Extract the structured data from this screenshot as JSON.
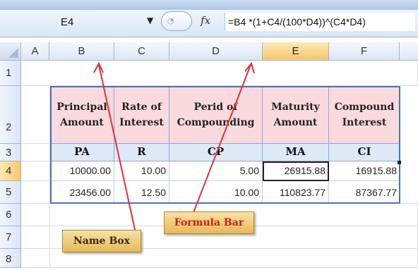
{
  "formula_bar": {
    "name_box": "E4",
    "fx_label": "fx",
    "formula": "=B4 *(1+C4/(100*D4))^(C4*D4)"
  },
  "columns": [
    "A",
    "B",
    "C",
    "D",
    "E",
    "F"
  ],
  "rows": [
    "1",
    "2",
    "3",
    "4",
    "5",
    "6",
    "7",
    "8"
  ],
  "table": {
    "headers": [
      [
        "Principal",
        "Amount"
      ],
      [
        "Rate of",
        "Interest"
      ],
      [
        "Perid of",
        "Compounding"
      ],
      [
        "Maturity",
        "Amount"
      ],
      [
        "Compound",
        "Interest"
      ]
    ],
    "abbrev": [
      "PA",
      "R",
      "CP",
      "MA",
      "CI"
    ],
    "data": [
      [
        "10000.00",
        "10.00",
        "5.00",
        "26915.88",
        "16915.88"
      ],
      [
        "23456.00",
        "12.50",
        "10.00",
        "110823.77",
        "87367.77"
      ]
    ]
  },
  "callouts": {
    "name_box": "Name Box",
    "formula_bar": "Formula Bar"
  },
  "colors": {
    "header_pink": "#fadadd",
    "subheader_blue": "#dde9f6",
    "callout_text_dark": "#3a2a10",
    "callout_text_red": "#d11a1a",
    "arrow_red": "#e0303a"
  }
}
